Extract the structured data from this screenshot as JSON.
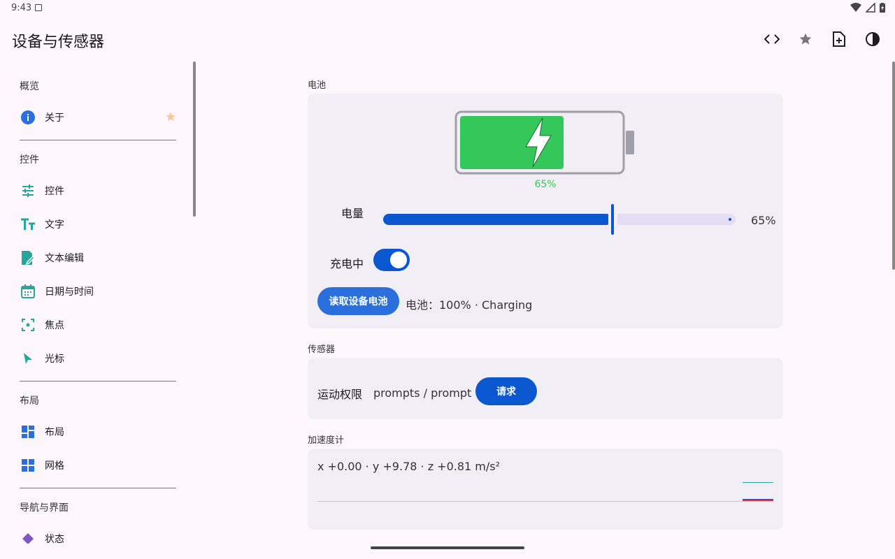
{
  "status_bar": {
    "time": "9:43"
  },
  "app_bar": {
    "title": "设备与传感器",
    "actions": [
      "code-icon",
      "star-icon",
      "note-add-icon",
      "contrast-icon"
    ]
  },
  "sidebar": {
    "sections": [
      {
        "header": "概览",
        "items": [
          {
            "label": "关于",
            "icon": "info-icon",
            "favorite": true
          }
        ]
      },
      {
        "header": "控件",
        "items": [
          {
            "label": "控件",
            "icon": "tune-icon"
          },
          {
            "label": "文字",
            "icon": "text-fields-icon"
          },
          {
            "label": "文本编辑",
            "icon": "edit-note-icon"
          },
          {
            "label": "日期与时间",
            "icon": "calendar-icon"
          },
          {
            "label": "焦点",
            "icon": "center-focus-icon"
          },
          {
            "label": "光标",
            "icon": "cursor-icon"
          }
        ]
      },
      {
        "header": "布局",
        "items": [
          {
            "label": "布局",
            "icon": "dashboard-icon"
          },
          {
            "label": "网格",
            "icon": "grid-icon"
          }
        ]
      },
      {
        "header": "导航与界面",
        "items": [
          {
            "label": "状态",
            "icon": "diamond-icon"
          }
        ]
      }
    ]
  },
  "battery": {
    "section_label": "电池",
    "level_pct_text": "65%",
    "level": 0.65,
    "slider_label": "电量",
    "slider_value_text": "65%",
    "charging_label": "充电中",
    "charging_on": true,
    "read_button": "读取设备电池",
    "device_status": "电池：100% · Charging",
    "colors": {
      "fill": "#34c759",
      "accent": "#0b57d0"
    }
  },
  "sensors": {
    "section_label": "传感器",
    "permission_label": "运动权限",
    "permission_value": "prompts / prompt",
    "request_button": "请求"
  },
  "accelerometer": {
    "section_label": "加速度计",
    "reading": "x +0.00 · y +9.78 · z +0.81 m/s²",
    "x": 0.0,
    "y": 9.78,
    "z": 0.81,
    "unit": "m/s²",
    "series_colors": [
      "#e53935",
      "#26a69a",
      "#3f51b5"
    ]
  }
}
